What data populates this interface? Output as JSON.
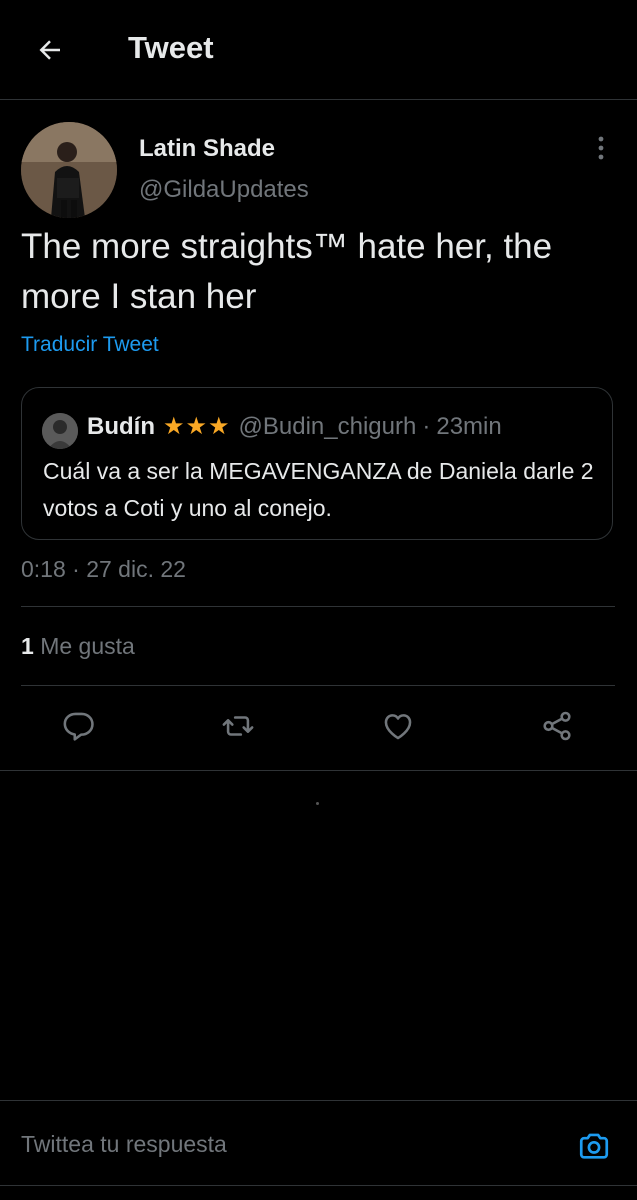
{
  "header": {
    "title": "Tweet",
    "back_icon": "arrow-left-icon"
  },
  "tweet": {
    "author_name": "Latin Shade",
    "author_handle": "@GildaUpdates",
    "text": "The more straights™ hate her, the more I stan her",
    "translate_label": "Traducir Tweet",
    "timestamp": "0:18 · 27 dic. 22",
    "likes_count": "1",
    "likes_label": "Me gusta",
    "more_icon": "more-vertical-icon"
  },
  "quoted_tweet": {
    "author_name": "Budín",
    "stars": "★★★",
    "author_handle": "@Budin_chigurh",
    "separator": "·",
    "time": "23min",
    "text": "Cuál va a ser la MEGAVENGANZA de Daniela darle 2 votos a Coti y uno al conejo."
  },
  "actions": {
    "reply_icon": "reply-icon",
    "retweet_icon": "retweet-icon",
    "like_icon": "heart-icon",
    "share_icon": "share-icon"
  },
  "reply_bar": {
    "placeholder": "Twittea tu respuesta",
    "camera_icon": "camera-icon"
  },
  "colors": {
    "background": "#000000",
    "primary_text": "#e7e9ea",
    "secondary_text": "#71767b",
    "link": "#1d9bf0",
    "divider": "#2f3336",
    "star": "#f9a825"
  }
}
